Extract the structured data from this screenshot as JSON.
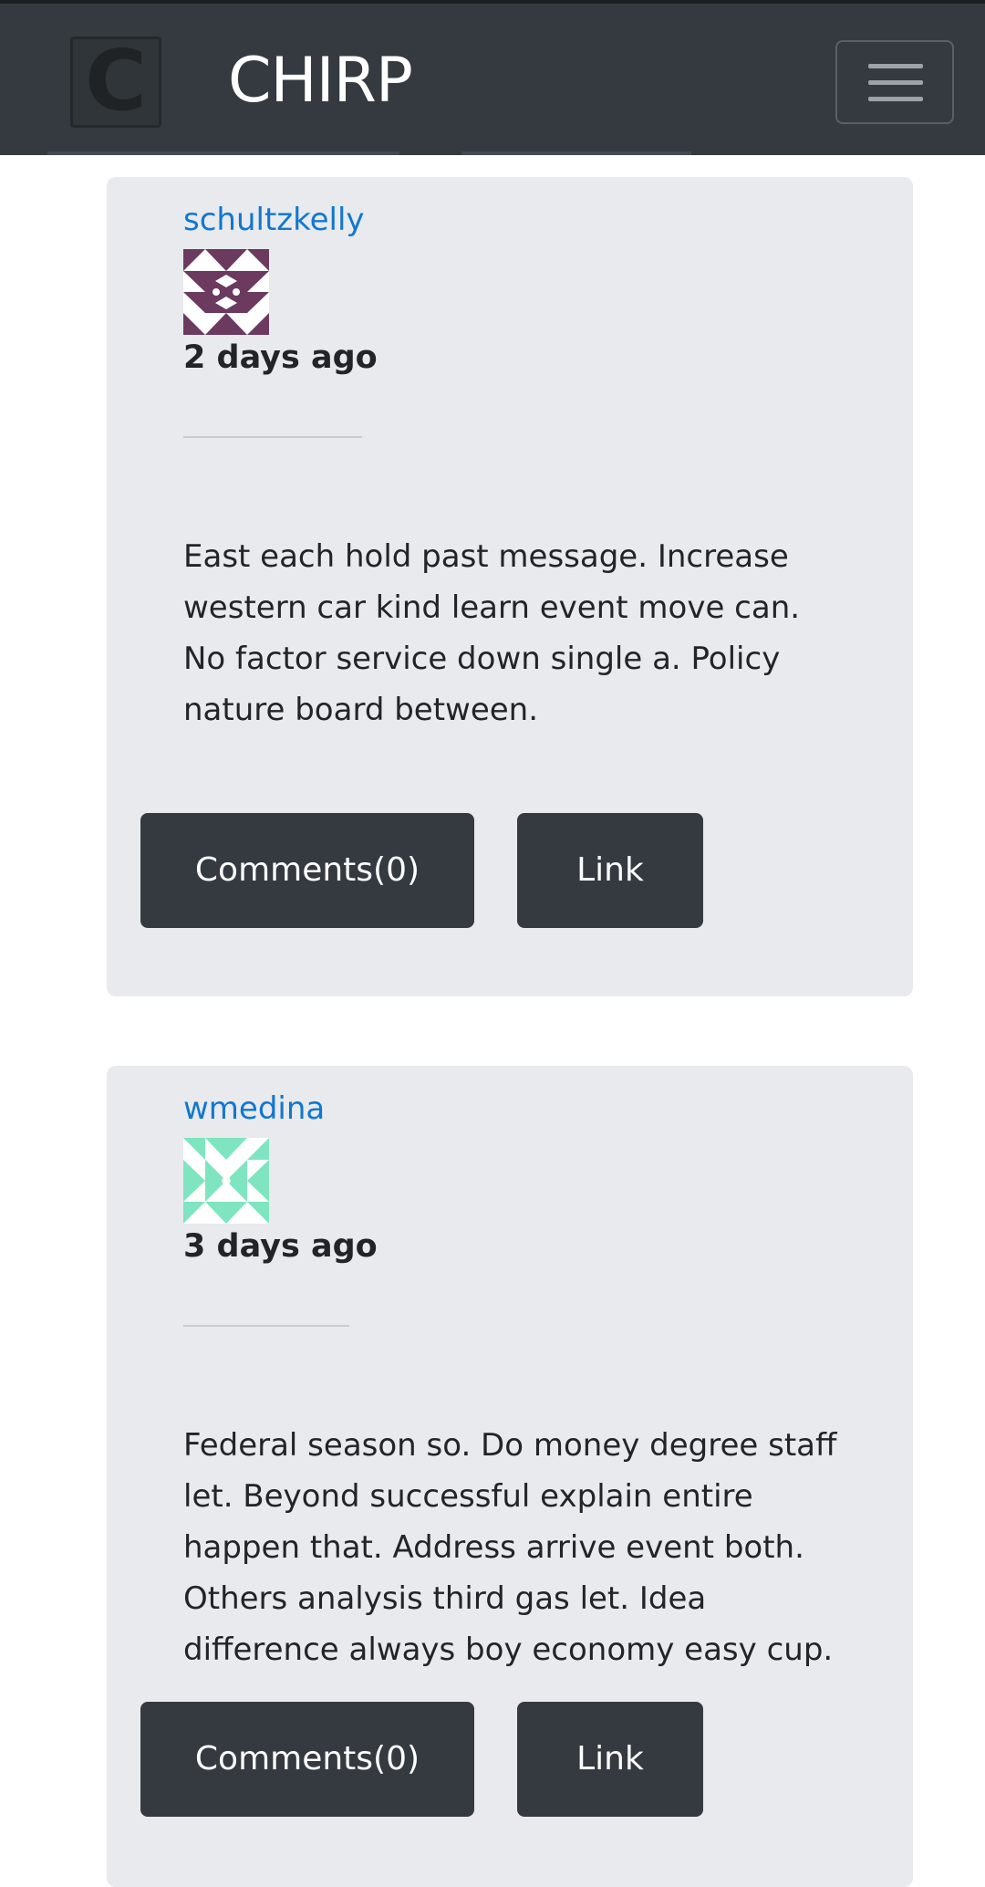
{
  "header": {
    "logo_letter": "C",
    "brand": "CHIRP"
  },
  "posts": [
    {
      "author": "schultzkelly",
      "avatar_icon": "identicon-avatar",
      "avatar_color": "#6b3a5e",
      "time": "2 days ago",
      "body": "East each hold past message. Increase western car kind learn event move can. No factor service down single a. Policy nature board between.",
      "comments_label": "Comments(0)",
      "link_label": "Link"
    },
    {
      "author": "wmedina",
      "avatar_icon": "identicon-avatar",
      "avatar_color": "#7ee5c0",
      "time": "3 days ago",
      "body": "Federal season so. Do money degree staff let. Beyond successful explain entire happen that. Address arrive event both. Others analysis third gas let. Idea difference always boy economy easy cup.",
      "comments_label": "Comments(0)",
      "link_label": "Link"
    }
  ]
}
